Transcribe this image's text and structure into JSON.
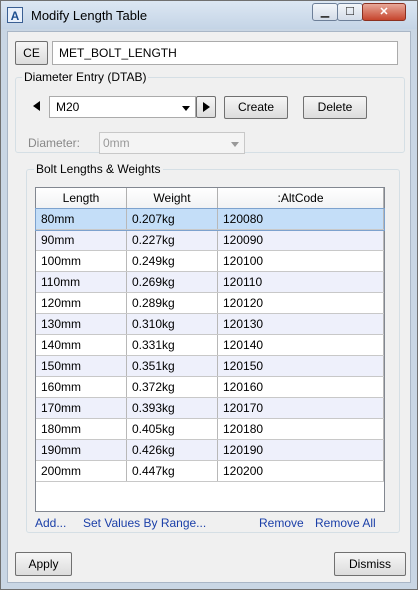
{
  "window": {
    "title": "Modify Length Table",
    "app_icon_letter": "A",
    "min_glyph": "▁",
    "max_glyph": "☐",
    "close_glyph": "✕"
  },
  "header": {
    "ce_label": "CE",
    "table_name": "MET_BOLT_LENGTH"
  },
  "diameter_entry": {
    "group_label": "Diameter Entry (DTAB)",
    "selected": "M20",
    "create_label": "Create",
    "delete_label": "Delete",
    "diameter_label": "Diameter:",
    "diameter_value": "0mm"
  },
  "bolt_group": {
    "label": "Bolt Lengths & Weights",
    "columns": [
      "Length",
      "Weight",
      ":AltCode"
    ],
    "rows": [
      [
        "80mm",
        "0.207kg",
        "120080"
      ],
      [
        "90mm",
        "0.227kg",
        "120090"
      ],
      [
        "100mm",
        "0.249kg",
        "120100"
      ],
      [
        "110mm",
        "0.269kg",
        "120110"
      ],
      [
        "120mm",
        "0.289kg",
        "120120"
      ],
      [
        "130mm",
        "0.310kg",
        "120130"
      ],
      [
        "140mm",
        "0.331kg",
        "120140"
      ],
      [
        "150mm",
        "0.351kg",
        "120150"
      ],
      [
        "160mm",
        "0.372kg",
        "120160"
      ],
      [
        "170mm",
        "0.393kg",
        "120170"
      ],
      [
        "180mm",
        "0.405kg",
        "120180"
      ],
      [
        "190mm",
        "0.426kg",
        "120190"
      ],
      [
        "200mm",
        "0.447kg",
        "120200"
      ]
    ],
    "selected_row": 0
  },
  "links": {
    "add": "Add...",
    "set_range": "Set Values By Range...",
    "remove": "Remove",
    "remove_all": "Remove All"
  },
  "footer": {
    "apply": "Apply",
    "dismiss": "Dismiss"
  }
}
